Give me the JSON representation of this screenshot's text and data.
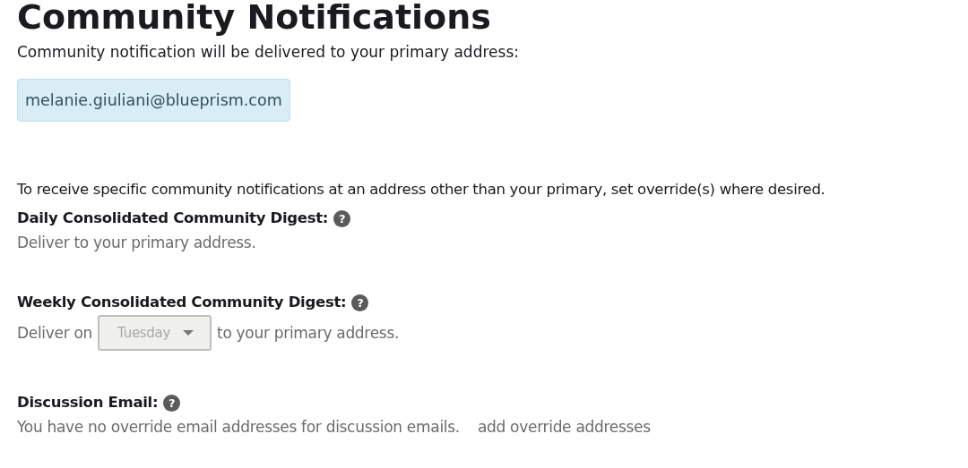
{
  "title": "Community Notifications",
  "intro": "Community notification will be delivered to your primary address:",
  "primary_email": "melanie.giuliani@blueprism.com",
  "override_note": "To receive specific community notifications at an address other than your primary, set override(s) where desired.",
  "sections": [
    {
      "kind": "text",
      "heading": "Daily Consolidated Community Digest:",
      "help": "?",
      "text": "Deliver to your primary address."
    },
    {
      "kind": "select",
      "heading": "Weekly Consolidated Community Digest:",
      "help": "?",
      "before": "Deliver on",
      "select": {
        "value": "Tuesday",
        "disabled": true
      },
      "after": "to your primary address."
    },
    {
      "kind": "override",
      "heading": "Discussion Email:",
      "help": "?",
      "text": "You have no override email addresses for discussion emails.",
      "link": "add override addresses"
    }
  ]
}
